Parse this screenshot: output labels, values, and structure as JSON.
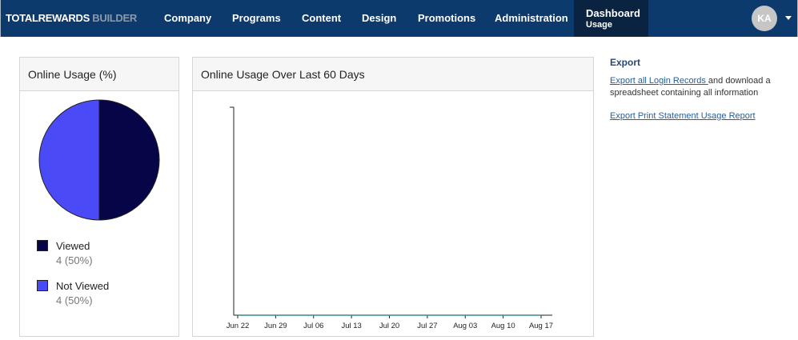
{
  "brand": {
    "part1": "TOTALREWARDS",
    "part2": " BUILDER"
  },
  "nav": {
    "items": [
      "Company",
      "Programs",
      "Content",
      "Design",
      "Promotions",
      "Administration"
    ],
    "active": {
      "line1": "Dashboard",
      "line2": "Usage"
    }
  },
  "user": {
    "initials": "KA"
  },
  "usage_panel": {
    "title": "Online Usage (%)",
    "legend": [
      {
        "label": "Viewed",
        "value": "4 (50%)",
        "color": "#050548"
      },
      {
        "label": "Not Viewed",
        "value": "4 (50%)",
        "color": "#4a4af6"
      }
    ]
  },
  "trend_panel": {
    "title": "Online Usage Over Last 60 Days"
  },
  "export": {
    "title": "Export",
    "login_link": "Export all Login Records ",
    "login_text": "and download a spreadsheet containing all information",
    "print_link": "Export Print Statement Usage Report"
  },
  "colors": {
    "header_bg": "#0d3a6c",
    "active_nav_bg": "#0a2340",
    "viewed": "#050548",
    "not_viewed": "#4a4af6"
  },
  "chart_data": [
    {
      "type": "pie",
      "categories": [
        "Viewed",
        "Not Viewed"
      ],
      "values": [
        4,
        4
      ],
      "colors": [
        "#050548",
        "#4a4af6"
      ],
      "title": "Online Usage (%)"
    },
    {
      "type": "line",
      "title": "Online Usage Over Last 60 Days",
      "x_tick_labels": [
        "Jun 22",
        "Jun 29",
        "Jul 06",
        "Jul 13",
        "Jul 20",
        "Jul 27",
        "Aug 03",
        "Aug 10",
        "Aug 17"
      ],
      "series": [
        {
          "values": [
            0,
            0,
            0,
            0,
            0,
            0,
            0,
            0,
            0
          ]
        }
      ]
    }
  ]
}
